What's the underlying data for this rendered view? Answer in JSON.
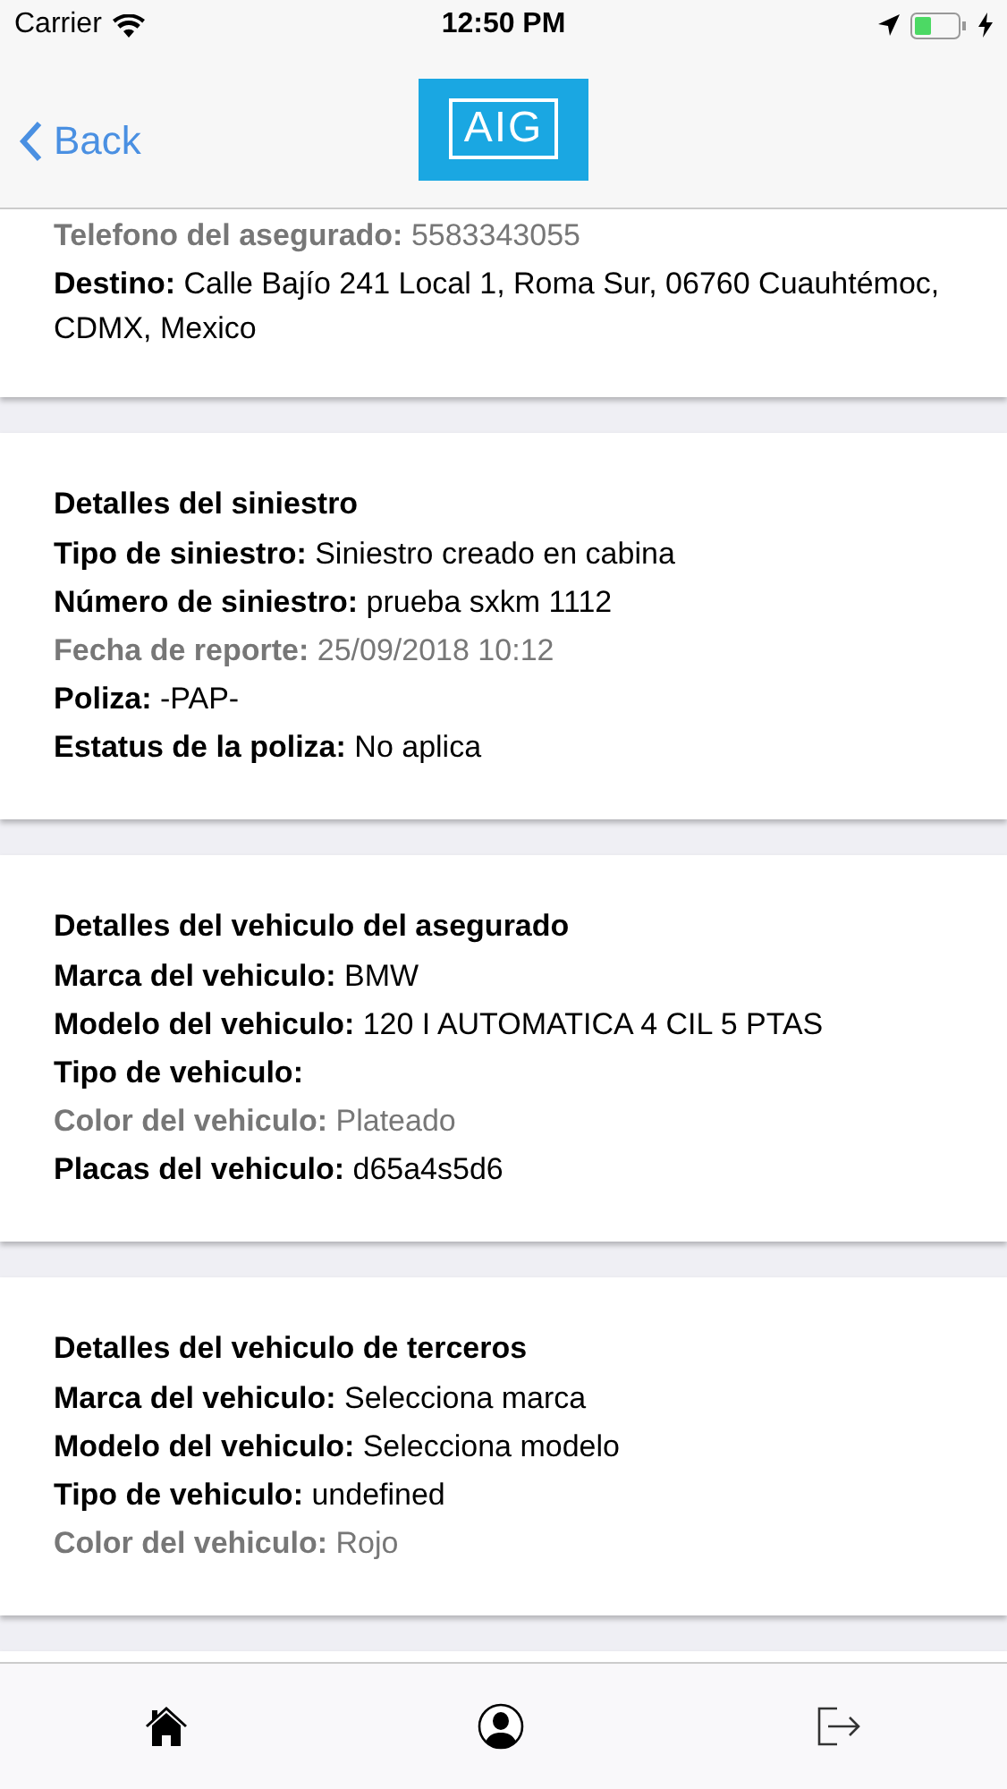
{
  "status_bar": {
    "carrier": "Carrier",
    "time": "12:50 PM"
  },
  "nav_bar": {
    "back": "Back",
    "logo": "AIG"
  },
  "cards": [
    {
      "fields": [
        {
          "label": "Telefono del asegurado:",
          "value": "5583343055",
          "muted": true
        },
        {
          "label": "Destino:",
          "value": "Calle Bajío 241 Local 1, Roma Sur, 06760 Cuauhtémoc, CDMX, Mexico",
          "muted": false
        }
      ]
    },
    {
      "title": "Detalles del siniestro",
      "fields": [
        {
          "label": "Tipo de siniestro:",
          "value": "Siniestro creado en cabina",
          "muted": false
        },
        {
          "label": "Número de siniestro:",
          "value": "prueba sxkm 1112",
          "muted": false
        },
        {
          "label": "Fecha de reporte:",
          "value": "25/09/2018 10:12",
          "muted": true
        },
        {
          "label": "Poliza:",
          "value": "-PAP-",
          "muted": false
        },
        {
          "label": "Estatus de la poliza:",
          "value": "No aplica",
          "muted": false
        }
      ]
    },
    {
      "title": "Detalles del vehiculo del asegurado",
      "fields": [
        {
          "label": "Marca del vehiculo:",
          "value": "BMW",
          "muted": false
        },
        {
          "label": "Modelo del vehiculo:",
          "value": "120 I AUTOMATICA 4 CIL 5 PTAS",
          "muted": false
        },
        {
          "label": "Tipo de vehiculo:",
          "muted": false
        },
        {
          "label": "Color del vehiculo:",
          "value": "Plateado",
          "muted": true
        },
        {
          "label": "Placas del vehiculo:",
          "value": "d65a4s5d6",
          "muted": false
        }
      ]
    },
    {
      "title": "Detalles del vehiculo de terceros",
      "fields": [
        {
          "label": "Marca del vehiculo:",
          "value": "Selecciona marca",
          "muted": false
        },
        {
          "label": "Modelo del vehiculo:",
          "value": "Selecciona modelo",
          "muted": false
        },
        {
          "label": "Tipo de vehiculo:",
          "value": "undefined",
          "muted": false
        },
        {
          "label": "Color del vehiculo:",
          "value": "Rojo",
          "muted": true
        }
      ]
    }
  ],
  "tab_bar": [
    {
      "kind": "home"
    },
    {
      "kind": "profile"
    },
    {
      "kind": "logout"
    }
  ]
}
